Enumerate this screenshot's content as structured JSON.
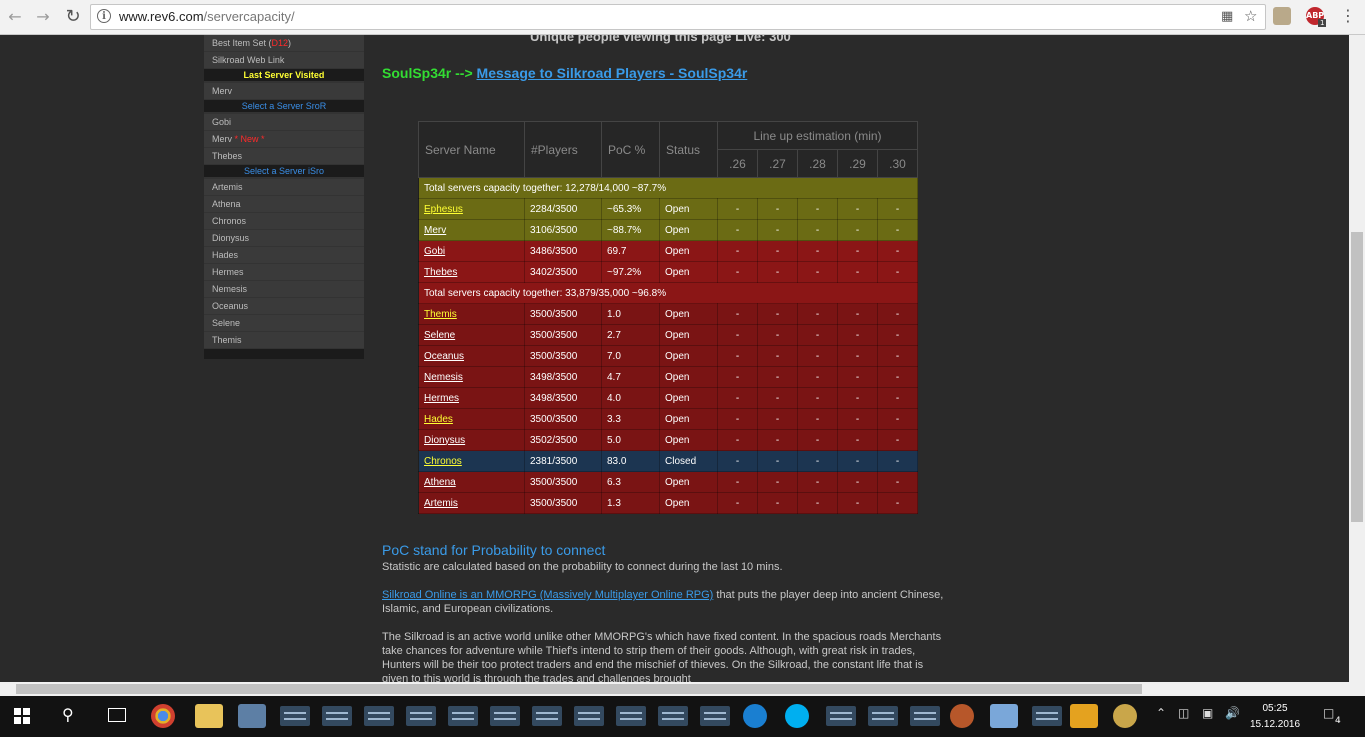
{
  "browser": {
    "url_host": "www.rev6.com",
    "url_path": "/servercapacity/",
    "ext_label": "ABP",
    "ext_badge": "1"
  },
  "page": {
    "live_text": "Unique people viewing this page Live: 300",
    "msg_prefix": "SoulSp34r -->",
    "msg_link": "Message to Silkroad Players - SoulSp34r"
  },
  "sidebar": {
    "items_top": [
      {
        "label": "Best Item Set (",
        "tail": "D12",
        "end": ")"
      },
      {
        "label": "Silkroad Web Link"
      }
    ],
    "head_last": "Last Server Visited",
    "last_server": "Merv",
    "head_sror": "Select a Server SroR",
    "sror_items": [
      {
        "label": "Gobi",
        "extra": ""
      },
      {
        "label": "Merv",
        "extra": "* New *"
      },
      {
        "label": "Thebes",
        "extra": ""
      }
    ],
    "head_isro": "Select a Server iSro",
    "isro_items": [
      "Artemis",
      "Athena",
      "Chronos",
      "Dionysus",
      "Hades",
      "Hermes",
      "Nemesis",
      "Oceanus",
      "Selene",
      "Themis"
    ]
  },
  "table": {
    "headers": {
      "name": "Server Name",
      "players": "#Players",
      "poc": "PoC %",
      "status": "Status",
      "lineup": "Line up estimation (min)",
      "cols": [
        ".26",
        ".27",
        ".28",
        ".29",
        ".30"
      ]
    },
    "total1": "Total servers capacity together: 12,278/14,000 ~87.7%",
    "group1": [
      {
        "name": "Ephesus",
        "players": "2284/3500",
        "poc": "~65.3%",
        "status": "Open",
        "row": "olive",
        "yel": true
      },
      {
        "name": "Merv",
        "players": "3106/3500",
        "poc": "~88.7%",
        "status": "Open",
        "row": "olive",
        "yel": false
      },
      {
        "name": "Gobi",
        "players": "3486/3500",
        "poc": "69.7",
        "status": "Open",
        "row": "redrow",
        "yel": false
      },
      {
        "name": "Thebes",
        "players": "3402/3500",
        "poc": "~97.2%",
        "status": "Open",
        "row": "redrow",
        "yel": false
      }
    ],
    "total2": "Total servers capacity together: 33,879/35,000 ~96.8%",
    "group2": [
      {
        "name": "Themis",
        "players": "3500/3500",
        "poc": "1.0",
        "status": "Open",
        "row": "darkred",
        "yel": true
      },
      {
        "name": "Selene",
        "players": "3500/3500",
        "poc": "2.7",
        "status": "Open",
        "row": "darkred",
        "yel": false
      },
      {
        "name": "Oceanus",
        "players": "3500/3500",
        "poc": "7.0",
        "status": "Open",
        "row": "darkred",
        "yel": false
      },
      {
        "name": "Nemesis",
        "players": "3498/3500",
        "poc": "4.7",
        "status": "Open",
        "row": "darkred",
        "yel": false
      },
      {
        "name": "Hermes",
        "players": "3498/3500",
        "poc": "4.0",
        "status": "Open",
        "row": "darkred",
        "yel": false
      },
      {
        "name": "Hades",
        "players": "3500/3500",
        "poc": "3.3",
        "status": "Open",
        "row": "darkred",
        "yel": true
      },
      {
        "name": "Dionysus",
        "players": "3502/3500",
        "poc": "5.0",
        "status": "Open",
        "row": "darkred",
        "yel": false
      },
      {
        "name": "Chronos",
        "players": "2381/3500",
        "poc": "83.0",
        "status": "Closed",
        "row": "blue-row",
        "yel": true
      },
      {
        "name": "Athena",
        "players": "3500/3500",
        "poc": "6.3",
        "status": "Open",
        "row": "darkred",
        "yel": false
      },
      {
        "name": "Artemis",
        "players": "3500/3500",
        "poc": "1.3",
        "status": "Open",
        "row": "darkred",
        "yel": false
      }
    ],
    "dash": "-"
  },
  "content": {
    "poc_heading": "PoC stand for Probability to connect",
    "poc_desc": "Statistic are calculated based on the probability to connect during the last 10 mins.",
    "p2_link": "Silkroad Online is an MMORPG (Massively Multiplayer Online RPG)",
    "p2_rest": " that puts the player deep into ancient Chinese, Islamic, and European civilizations.",
    "p3": "The Silkroad is an active world unlike other MMORPG's which have fixed content. In the spacious roads Merchants take chances for adventure while Thief's intend to strip them of their goods. Although, with great risk in trades, Hunters will be their too protect traders and end the mischief of thieves. On the Silkroad, the constant life that is given to this world is through the trades and challenges brought"
  },
  "taskbar": {
    "time": "05:25",
    "date": "15.12.2016",
    "notif": "4"
  }
}
